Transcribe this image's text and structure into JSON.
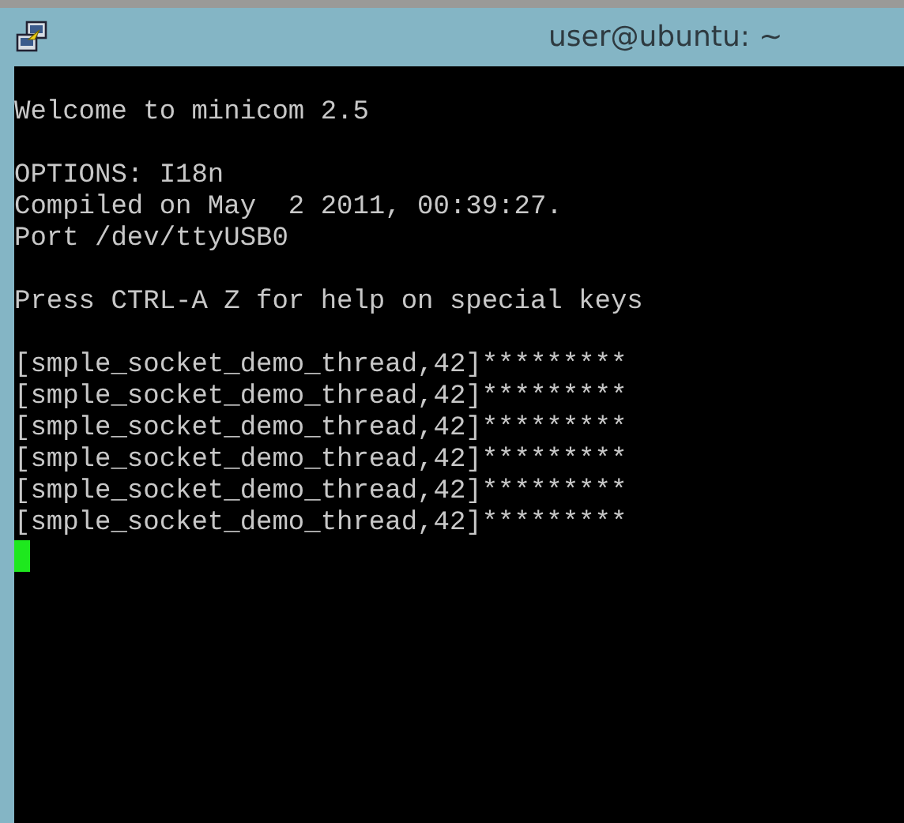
{
  "window": {
    "title": "user@ubuntu: ~"
  },
  "terminal": {
    "blocks": [
      [
        "Welcome to minicom 2.5"
      ],
      [
        "OPTIONS: I18n",
        "Compiled on May  2 2011, 00:39:27.",
        "Port /dev/ttyUSB0"
      ],
      [
        "Press CTRL-A Z for help on special keys"
      ],
      [
        "[smple_socket_demo_thread,42]*********",
        "[smple_socket_demo_thread,42]*********",
        "[smple_socket_demo_thread,42]*********",
        "[smple_socket_demo_thread,42]*********",
        "[smple_socket_demo_thread,42]*********",
        "[smple_socket_demo_thread,42]*********"
      ]
    ]
  }
}
